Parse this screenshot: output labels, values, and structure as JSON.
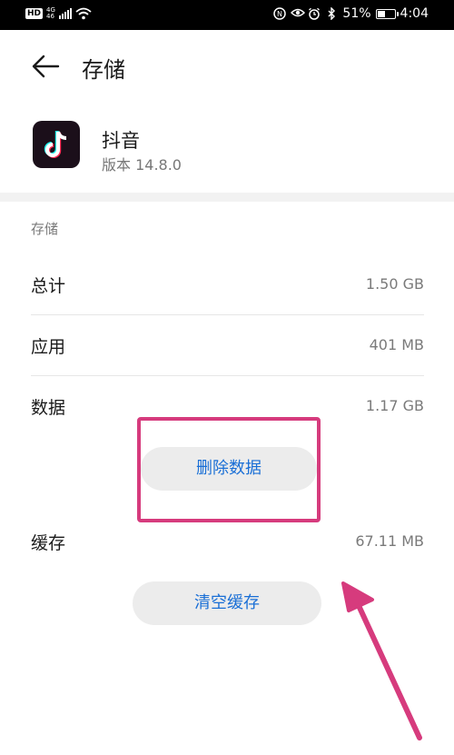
{
  "status_bar": {
    "hd": "HD",
    "net_type": "4G",
    "net_sub": "46",
    "battery_pct": "51%",
    "battery_level": 0.51,
    "time": "4:04"
  },
  "header": {
    "title": "存储"
  },
  "app": {
    "name": "抖音",
    "version": "版本 14.8.0"
  },
  "storage": {
    "section_label": "存储",
    "total": {
      "label": "总计",
      "value": "1.50 GB"
    },
    "app": {
      "label": "应用",
      "value": "401 MB"
    },
    "data": {
      "label": "数据",
      "value": "1.17 GB"
    },
    "delete_data_button": "删除数据",
    "cache": {
      "label": "缓存",
      "value": "67.11 MB"
    },
    "clear_cache_button": "清空缓存"
  },
  "colors": {
    "accent": "#1a6fd6",
    "highlight": "#d63b7d"
  }
}
